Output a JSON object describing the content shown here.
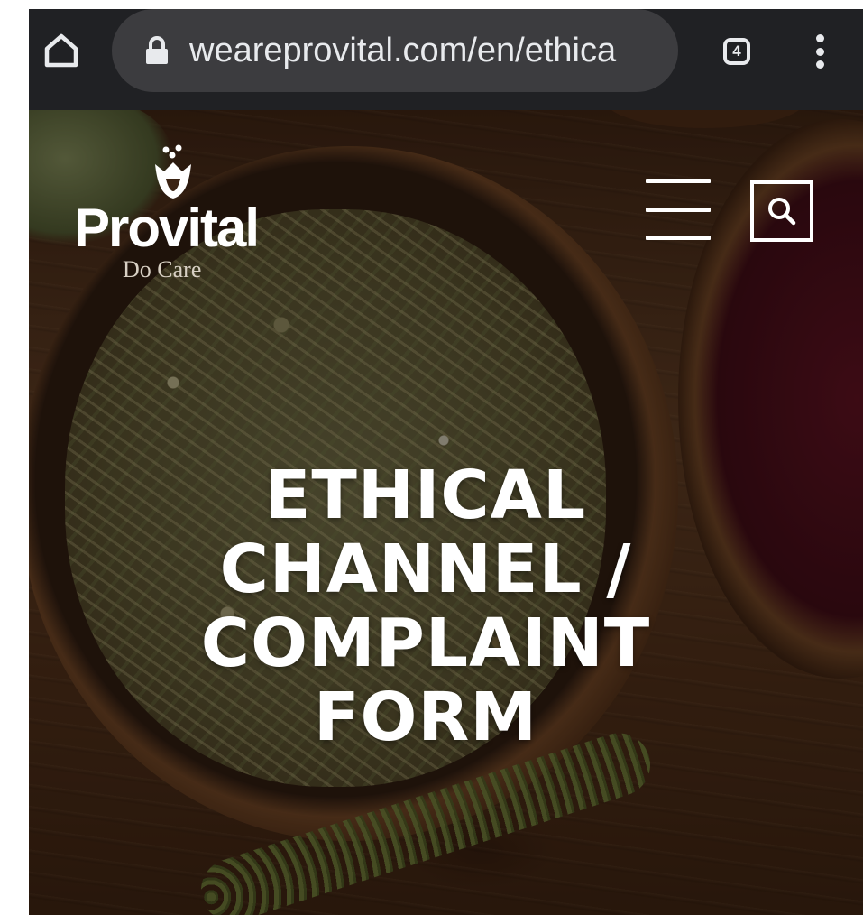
{
  "browser": {
    "url": "weareprovital.com/en/ethica",
    "tab_count": "4",
    "colors": {
      "toolbar": "#202124",
      "url_pill": "#3c3c3f",
      "text": "#e8eaed"
    }
  },
  "site": {
    "logo_name": "Provital",
    "logo_tagline": "Do Care",
    "icons": {
      "menu": "hamburger-menu-icon",
      "search": "search-icon"
    }
  },
  "hero": {
    "title_lines": [
      "ETHICAL",
      "CHANNEL /",
      "COMPLAINT",
      "FORM"
    ]
  }
}
